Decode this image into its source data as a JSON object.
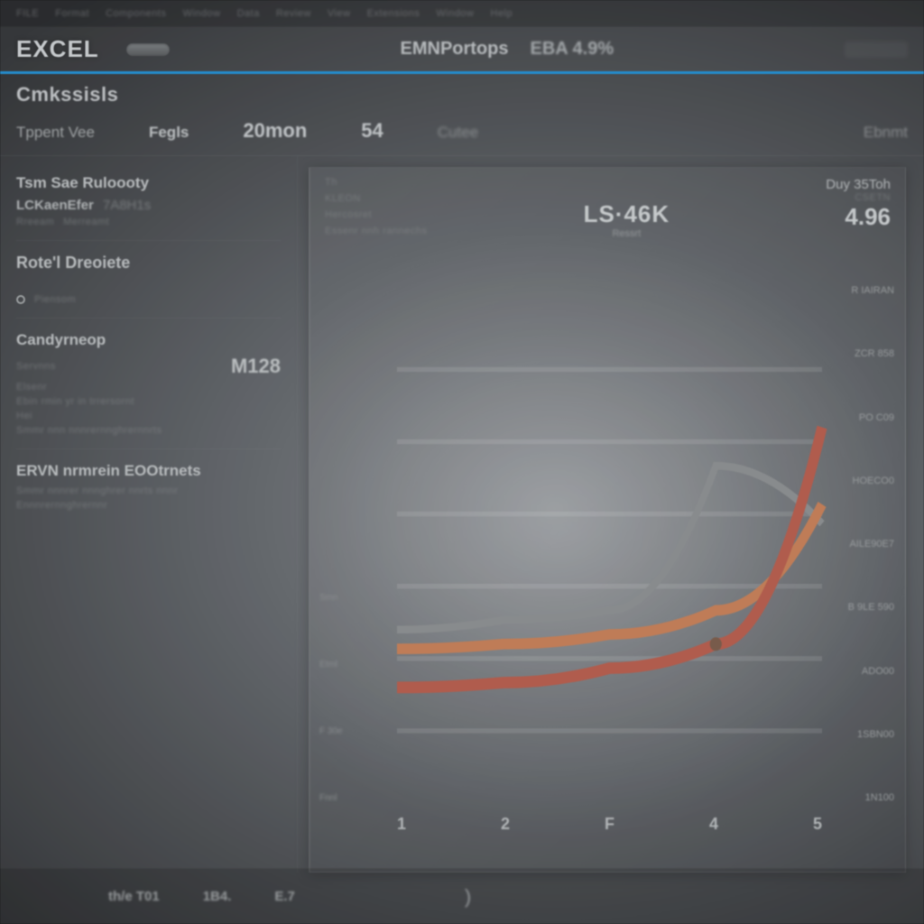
{
  "menubar": [
    "FILE",
    "Format",
    "Components",
    "Window",
    "Data",
    "Review",
    "View",
    "Extensions",
    "Window",
    "Help"
  ],
  "brandbar": {
    "brand": "EXCEL",
    "center_a": "EMNPortops",
    "center_b": "EBA 4.9%"
  },
  "subheader": {
    "title": "Cmkssisls",
    "tabs": [
      "Tppent Vee",
      "Fegls",
      "20mon",
      "54",
      "Cutee"
    ],
    "right": "Ebnmt"
  },
  "sidebar": {
    "block1": {
      "title": "Tsm Sae Ruloooty",
      "k": "LCKaenEfer",
      "v": "7A8H1s",
      "mini1": "Rreeam",
      "mini2": "Merreamt"
    },
    "block2": {
      "title": "Rote'l Dreoiete",
      "mini": "Piensom"
    },
    "block3": {
      "title": "Candyrneop",
      "k1": "Servnns",
      "big": "M128",
      "k2": "Elsenr",
      "mini1": "Ebin rmin yr in trrersornt",
      "k3": "Hei",
      "mini2": "Smmr nnn nnnrernnghrernnrts"
    },
    "block4": {
      "title": "ERVN nrmrein EOOtrnets",
      "mini1": "Smmr nnnrer nnnghrer nnrts nnnr",
      "mini2": "Ennnrernnghrernnr"
    }
  },
  "panel": {
    "top_left_minis": [
      "Th",
      "KLEON",
      "Hercosret",
      "Essenr nnh rannechs"
    ],
    "hero": "LS·46K",
    "hero_sub": "Ressrt",
    "top_right_minis": [
      "CSETN"
    ],
    "right_label": "Duy 35Toh",
    "right_value": "4.96",
    "left_ticks": [
      "",
      "",
      "",
      "",
      "",
      "",
      "Smn",
      "Etml",
      "F 30e",
      "Fnnl"
    ],
    "right_ticks": [
      "R IAIRAN",
      "ZCR 858",
      "PO C09",
      "HOECO0",
      "AILE90E7",
      "B 9LE 590",
      "ADO00",
      "1SBN00",
      "1N100"
    ],
    "x_ticks": [
      "1",
      "2",
      "F",
      "4",
      "5"
    ]
  },
  "footer": [
    "th/e  T01",
    "1B4.",
    "E.7",
    ")"
  ],
  "chart_data": {
    "type": "line",
    "x": [
      1,
      2,
      3,
      4,
      5
    ],
    "series": [
      {
        "name": "orange",
        "values": [
          0.32,
          0.33,
          0.35,
          0.4,
          0.62
        ]
      },
      {
        "name": "red",
        "values": [
          0.24,
          0.25,
          0.28,
          0.33,
          0.78
        ]
      },
      {
        "name": "grey",
        "values": [
          0.36,
          0.38,
          0.4,
          0.7,
          0.58
        ]
      }
    ],
    "ylim": [
      0,
      1
    ],
    "title": "LS·46K",
    "right_value": "4.96",
    "right_label": "Duy 35Toh",
    "x_ticks": [
      "1",
      "2",
      "F",
      "4",
      "5"
    ],
    "right_axis_labels": [
      "R IAIRAN",
      "ZCR 858",
      "PO C09",
      "HOECO0",
      "AILE90E7",
      "B 9LE 590",
      "ADO00",
      "1SBN00",
      "1N100"
    ]
  }
}
